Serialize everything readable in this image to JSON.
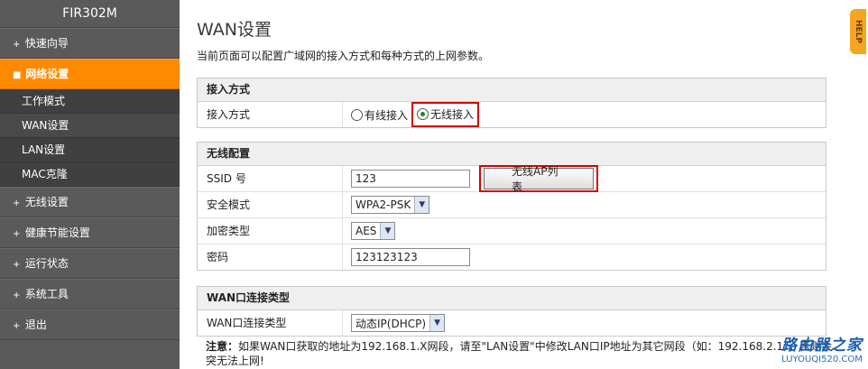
{
  "sidebar": {
    "brand": "FIR302M",
    "items": [
      {
        "label": "快速向导",
        "bullet": "+"
      },
      {
        "label": "网络设置",
        "bullet": "■",
        "active": true
      },
      {
        "label": "无线设置",
        "bullet": "+"
      },
      {
        "label": "健康节能设置",
        "bullet": "+"
      },
      {
        "label": "运行状态",
        "bullet": "+"
      },
      {
        "label": "系统工具",
        "bullet": "+"
      },
      {
        "label": "退出",
        "bullet": "+"
      }
    ],
    "subitems": [
      {
        "label": "工作模式"
      },
      {
        "label": "WAN设置",
        "active": true
      },
      {
        "label": "LAN设置"
      },
      {
        "label": "MAC克隆"
      }
    ]
  },
  "main": {
    "title": "WAN设置",
    "description": "当前页面可以配置广域网的接入方式和每种方式的上网参数。",
    "access": {
      "heading": "接入方式",
      "row_label": "接入方式",
      "options": [
        "有线接入",
        "无线接入"
      ],
      "selected": "无线接入"
    },
    "wireless": {
      "heading": "无线配置",
      "ssid_label": "SSID 号",
      "ssid_value": "123",
      "ap_list_button": "无线AP列表",
      "security_label": "安全模式",
      "security_value": "WPA2-PSK",
      "encryption_label": "加密类型",
      "encryption_value": "AES",
      "password_label": "密码",
      "password_value": "123123123"
    },
    "wan_type": {
      "heading": "WAN口连接类型",
      "row_label": "WAN口连接类型",
      "value": "动态IP(DHCP)"
    },
    "note_prefix": "注意：",
    "note_text": "如果WAN口获取的地址为192.168.1.X网段，请至\"LAN设置\"中修改LAN口IP地址为其它网段（如：192.168.2.1），否则会",
    "note_text2": "突无法上网!"
  },
  "help_label": "HELP",
  "watermark": {
    "title": "路由器之家",
    "url": "LUYOUQI520.COM"
  },
  "colors": {
    "accent": "#ff8a00",
    "sidebar": "#5a5a5a",
    "highlight_box": "#d40000"
  }
}
